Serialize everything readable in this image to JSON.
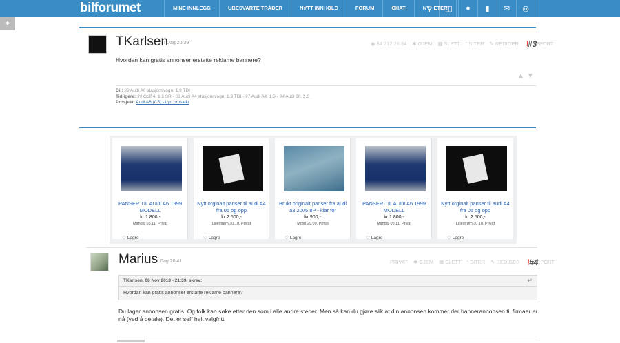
{
  "header": {
    "logo": "bilforumet",
    "nav": [
      "MINE INNLEGG",
      "UBESVARTE TRÅDER",
      "NYTT INNHOLD",
      "FORUM",
      "CHAT",
      "NYHETER"
    ],
    "icons": [
      "search-icon",
      "door-icon",
      "user-icon",
      "bookmark-icon",
      "mail-icon",
      "compass-icon"
    ]
  },
  "post1": {
    "username": "TKarlsen",
    "time": "I Dag 20:39",
    "ip": "84.212.26.84",
    "hide": "GJEM",
    "delete": "SLETT",
    "quote": "SITER",
    "edit": "REDIGER",
    "report": "REPORT",
    "number": "#3",
    "body": "Hvordan kan gratis annonser erstatte reklame bannere?",
    "sig": {
      "car_label": "Bil:",
      "car_year": "99",
      "car_text": "Audi A6 stasjonsvogn, 1.9 TDI",
      "prev_label": "Tidligere:",
      "prev_1_year": "99",
      "prev_1": "Golf 4, 1.6 SR -",
      "prev_2_year": "01",
      "prev_2": "Audi A4 stasjonsvogn, 1.9 TDI -",
      "prev_3_year": "97",
      "prev_3": "Audi A4, 1.6 -",
      "prev_4_year": "94",
      "prev_4": "Audi 80, 2.0",
      "project_label": "Prosjekt:",
      "project_link": "Audi A6 (C5) - Lyd prosjekt"
    }
  },
  "ads": [
    {
      "title": "PANSER TIL AUDI A6 1999 MODELL",
      "price": "kr 1 800,-",
      "location": "Mandal 05.11. Privat",
      "save": "Lagre",
      "image": "blue"
    },
    {
      "title": "Nytt orginalt panser til audi A4 fra 05 og opp",
      "price": "kr 2 500,-",
      "location": "Lillestrøm 30.10. Privat",
      "save": "Lagre",
      "image": "dark"
    },
    {
      "title": "Brukt originalt panser fra audi a3 2005 8P - klar for",
      "price": "kr 900,-",
      "location": "Moss 29.09. Privat",
      "save": "Lagre",
      "image": "teal"
    },
    {
      "title": "PANSER TIL AUDI A6 1999 MODELL",
      "price": "kr 1 800,-",
      "location": "Mandal 05.11. Privat",
      "save": "Lagre",
      "image": "blue"
    },
    {
      "title": "Nytt orginalt panser til audi A4 fra 05 og opp",
      "price": "kr 2 500,-",
      "location": "Lillestrøm 30.10. Privat",
      "save": "Lagre",
      "image": "dark"
    }
  ],
  "post2": {
    "username": "Marius",
    "time": "I Dag 20:41",
    "private": "PRIVAT",
    "hide": "GJEM",
    "delete": "SLETT",
    "quote": "SITER",
    "edit": "REDIGER",
    "report": "REPORT",
    "number": "#4",
    "quote_head": "TKarlsen, 08 Nov 2013 - 21:39, skrev:",
    "quote_text": "Hvordan kan gratis annonser erstatte reklame bannere?",
    "body": "Du lager annonsen gratis. Og folk kan søke etter den som i alle andre steder. Men så kan du gjøre slik at din annonsen kommer der bannerannonsen til firmaer er nå (ved å betale). Det er seff helt valgfritt."
  },
  "colors": {
    "brand": "#3a8dc4",
    "link": "#2a63b5"
  }
}
